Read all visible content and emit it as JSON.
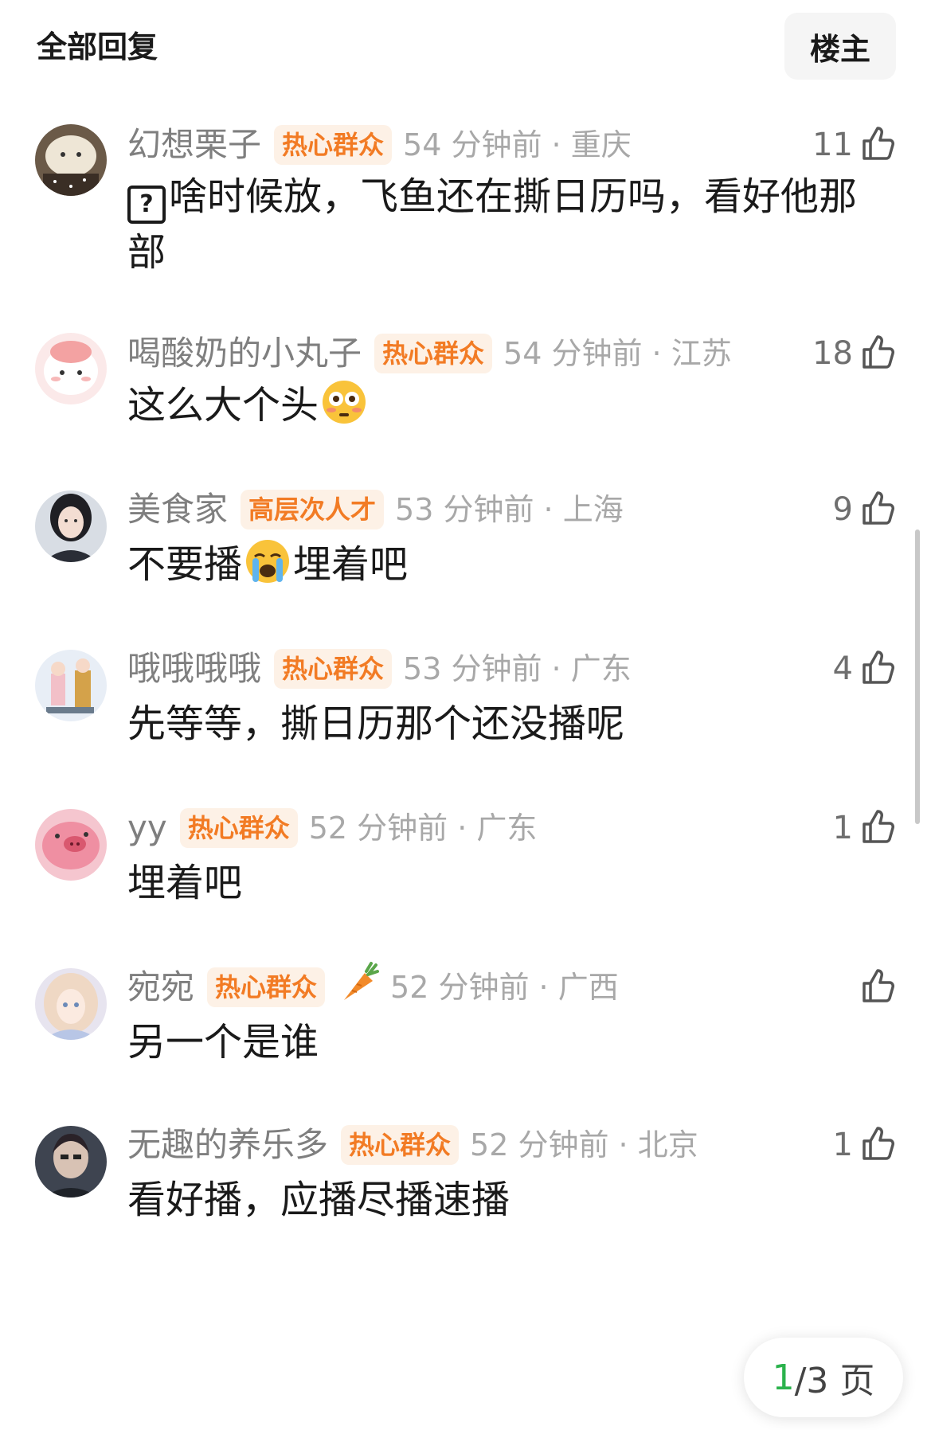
{
  "header": {
    "title": "全部回复",
    "filter_button": "楼主"
  },
  "comments": [
    {
      "username": "幻想栗子",
      "badge": "热心群众",
      "time": "54 分钟前 · 重庆",
      "likes": "11",
      "text": "啥时候放，飞鱼还在撕日历吗，看好他那部",
      "has_question_icon": true
    },
    {
      "username": "喝酸奶的小丸子",
      "badge": "热心群众",
      "time": "54 分钟前 · 江苏",
      "likes": "18",
      "text": "这么大个头"
    },
    {
      "username": "美食家",
      "badge": "高层次人才",
      "time": "53 分钟前 · 上海",
      "likes": "9",
      "text_before": "不要播",
      "text_after": "埋着吧"
    },
    {
      "username": "哦哦哦哦",
      "badge": "热心群众",
      "time": "53 分钟前 · 广东",
      "likes": "4",
      "text": "先等等，撕日历那个还没播呢"
    },
    {
      "username": "yy",
      "badge": "热心群众",
      "time": "52 分钟前 · 广东",
      "likes": "1",
      "text": "埋着吧"
    },
    {
      "username": "宛宛",
      "badge": "热心群众",
      "time": "52 分钟前 · 广西",
      "likes": "",
      "text": "另一个是谁"
    },
    {
      "username": "无趣的养乐多",
      "badge": "热心群众",
      "time": "52 分钟前 · 北京",
      "likes": "1",
      "text": "看好播，应播尽播速播"
    }
  ],
  "pager": {
    "current": "1",
    "total_label": "/3 页"
  },
  "colors": {
    "badge_text": "#f27b24",
    "badge_bg": "#fdf1e6",
    "meta_gray": "#a8a8a8",
    "pager_current": "#2bb24c"
  }
}
